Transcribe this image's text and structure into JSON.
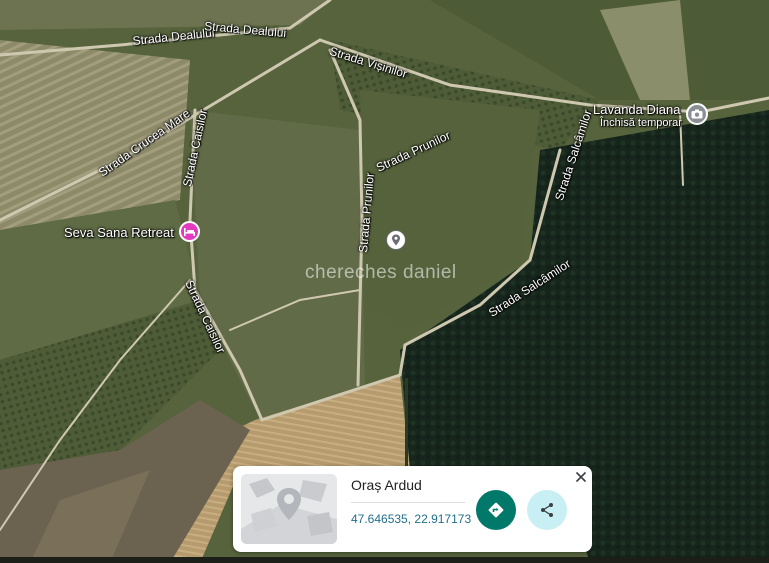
{
  "map": {
    "streets": [
      {
        "id": "dealului-1",
        "label": "Strada Dealului"
      },
      {
        "id": "dealului-2",
        "label": "Strada Dealului"
      },
      {
        "id": "visinilor",
        "label": "Strada Vișinilor"
      },
      {
        "id": "crucea-mare",
        "label": "Strada Crucea Mare"
      },
      {
        "id": "caisilor-1",
        "label": "Strada Caisilor"
      },
      {
        "id": "caisilor-2",
        "label": "Strada Caisilor"
      },
      {
        "id": "prunilor-1",
        "label": "Strada Prunilor"
      },
      {
        "id": "prunilor-2",
        "label": "Strada Prunilor"
      },
      {
        "id": "salcamilor-1",
        "label": "Strada Salcâmilor"
      },
      {
        "id": "salcamilor-2",
        "label": "Strada Salcâmilor"
      }
    ],
    "places": {
      "seva": {
        "name": "Seva Sana Retreat",
        "icon": "hotel-icon",
        "color": "#e33bbf"
      },
      "lavanda": {
        "name": "Lavanda Diana",
        "status": "Închisă temporar",
        "icon": "camera-icon",
        "color": "#8a8f94"
      }
    },
    "watermark": "chereches daniel",
    "selected_pin_icon": "location-pin-icon"
  },
  "card": {
    "title": "Oraș Ardud",
    "coords": "47.646535, 22.917173",
    "directions_icon": "directions-icon",
    "share_icon": "share-icon",
    "close_icon": "close-icon",
    "colors": {
      "directions": "#00796b",
      "share": "#c8eff3"
    }
  }
}
